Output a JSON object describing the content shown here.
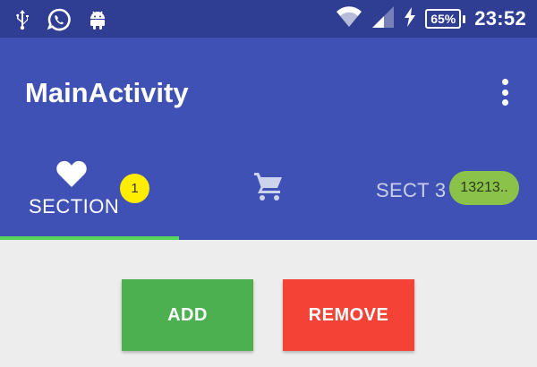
{
  "status_bar": {
    "icons": [
      "usb-icon",
      "whatsapp-icon",
      "android-icon",
      "wifi-icon",
      "signal-icon",
      "charging-icon"
    ],
    "battery_level": "65%",
    "time": "23:52"
  },
  "app_bar": {
    "title": "MainActivity",
    "color": "#3f51b5",
    "overflow_icon": "more-vert-icon"
  },
  "tabs": [
    {
      "icon": "heart-icon",
      "label": "SECTION",
      "badge": "1",
      "badge_color": "#ffee00",
      "selected": true
    },
    {
      "icon": "cart-icon",
      "label": "",
      "badge": "",
      "selected": false
    },
    {
      "icon": "",
      "label": "SECT 3",
      "badge": "13213..",
      "badge_color": "#8bc34a",
      "selected": false
    }
  ],
  "indicator_color": "#58d65c",
  "actions": {
    "add_label": "ADD",
    "add_color": "#4caf50",
    "remove_label": "REMOVE",
    "remove_color": "#f44336"
  }
}
